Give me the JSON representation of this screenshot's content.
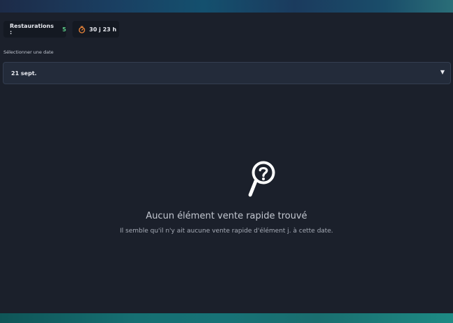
{
  "stats": {
    "restaurations_label": "Restaurations :",
    "restaurations_count": "5",
    "timer_icon": "stopwatch-icon",
    "timer_value": "30 j 23 h"
  },
  "date_picker": {
    "label": "Sélectionner une date",
    "selected": "21 sept.",
    "arrow": "▼"
  },
  "empty_state": {
    "icon": "search-question-icon",
    "title": "Aucun élément vente rapide trouvé",
    "subtitle": "Il semble qu'il n'y ait aucune vente rapide d'élément j. à cette date."
  },
  "colors": {
    "background": "#1b202b",
    "count_green": "#5ed08a",
    "timer_orange": "#f0883a"
  }
}
